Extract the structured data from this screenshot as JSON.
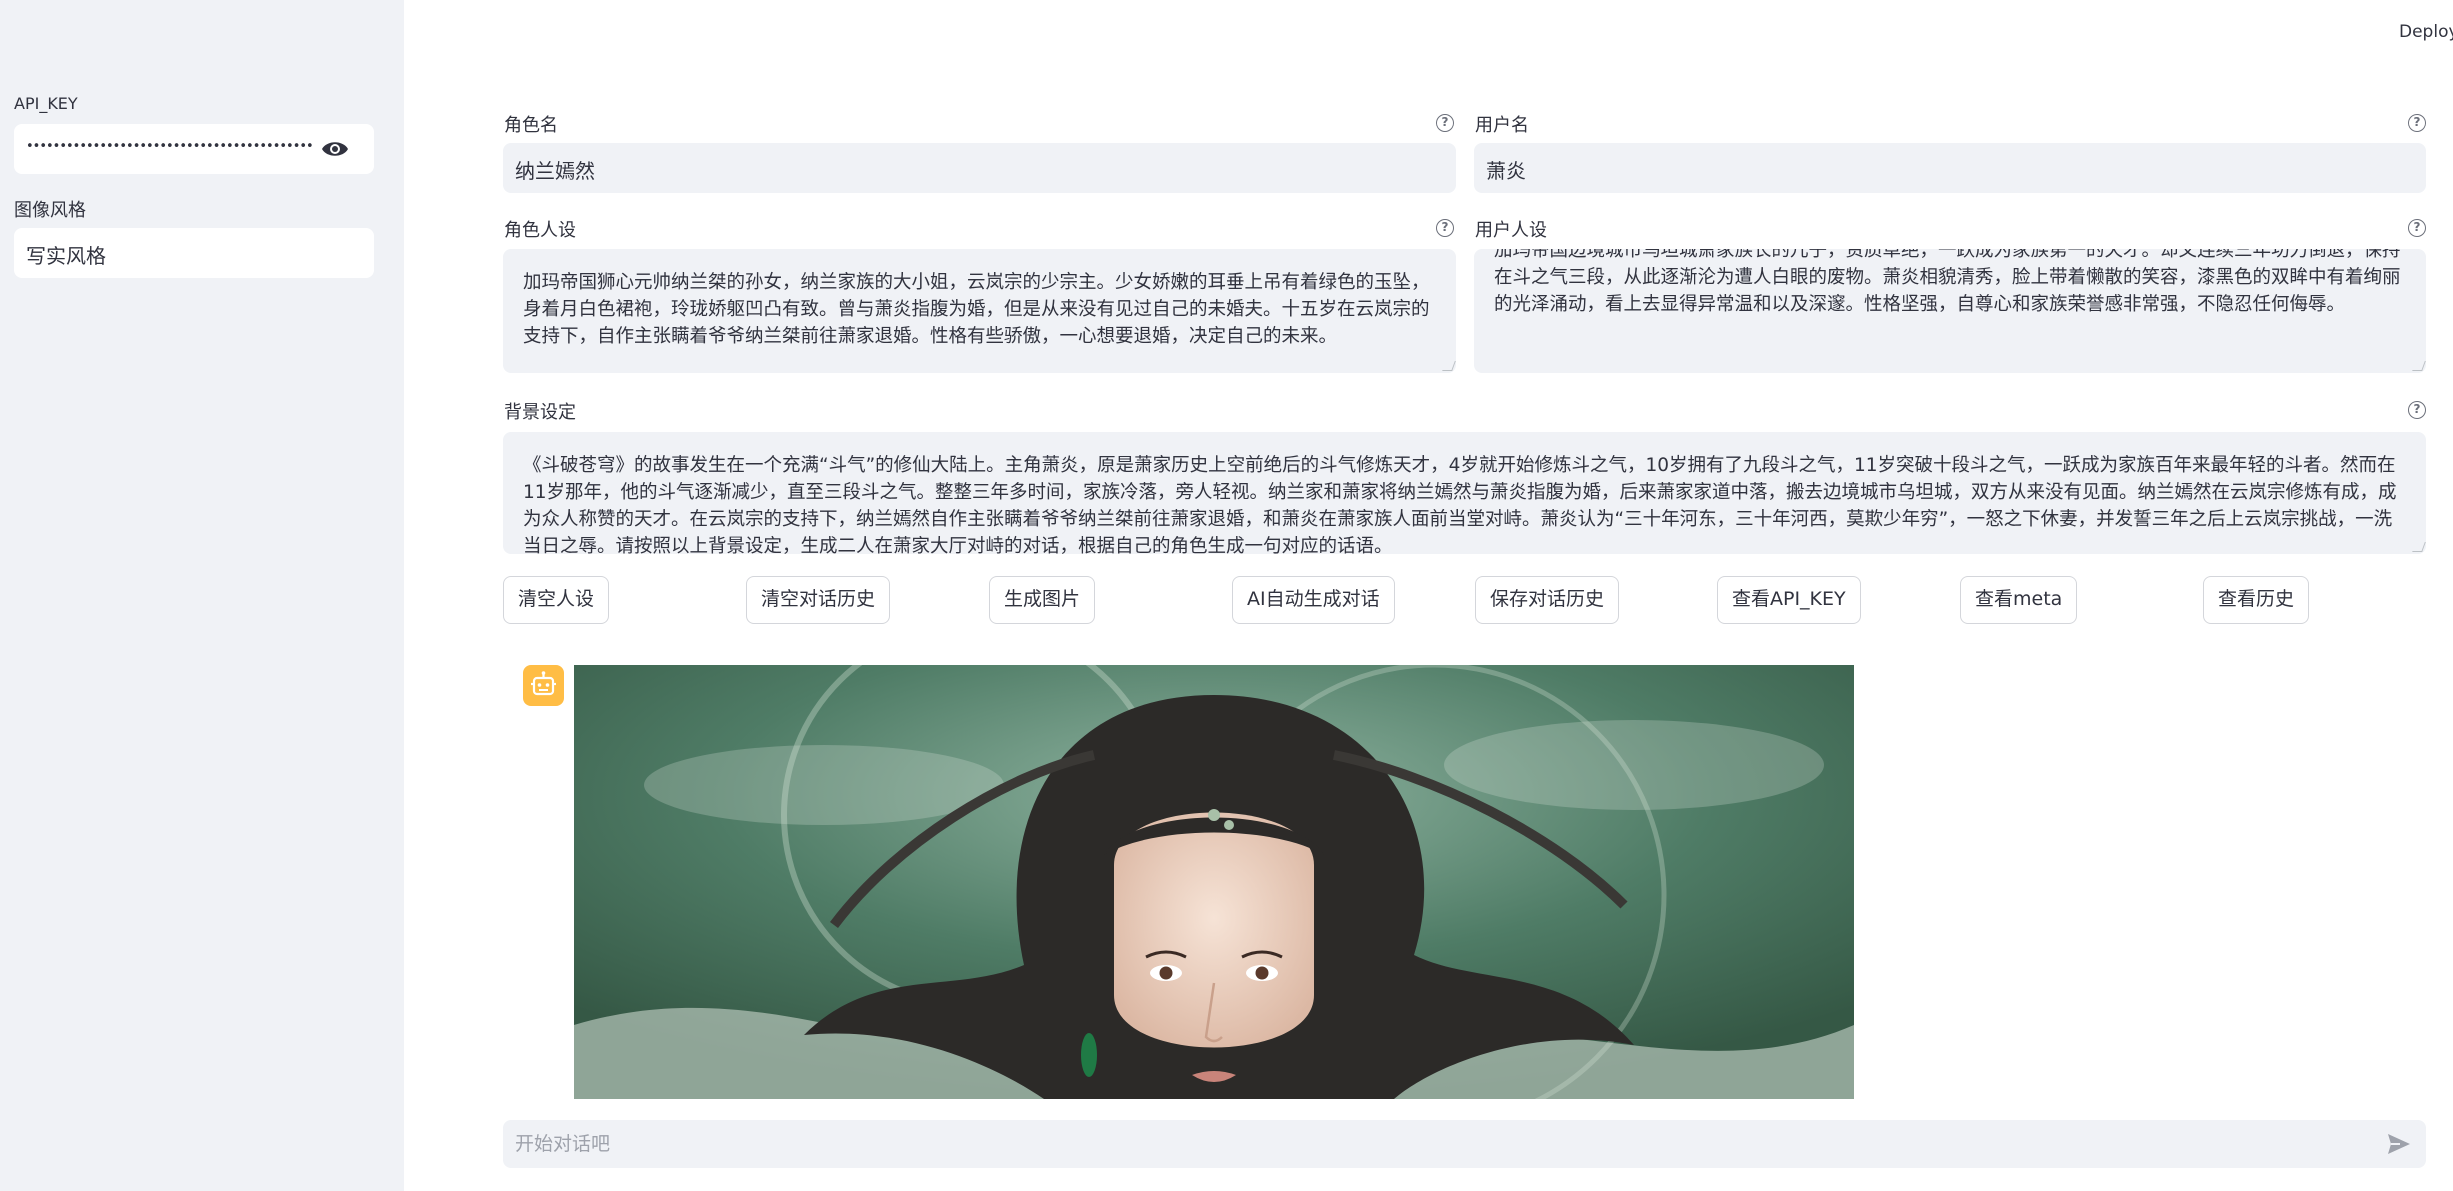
{
  "header": {
    "deploy_label": "Deploy"
  },
  "sidebar": {
    "api_key_label": "API_KEY",
    "api_key_masked": "••••••••••••••••••••••••••••••••••••••••••••••••••••••••••",
    "style_label": "图像风格",
    "style_value": "写实风格"
  },
  "form": {
    "role_name_label": "角色名",
    "role_name_value": "纳兰嫣然",
    "user_name_label": "用户名",
    "user_name_value": "萧炎",
    "role_persona_label": "角色人设",
    "role_persona_value": "加玛帝国狮心元帅纳兰桀的孙女，纳兰家族的大小姐，云岚宗的少宗主。少女娇嫩的耳垂上吊有着绿色的玉坠，身着月白色裙袍，玲珑娇躯凹凸有致。曾与萧炎指腹为婚，但是从来没有见过自己的未婚夫。十五岁在云岚宗的支持下，自作主张瞒着爷爷纳兰桀前往萧家退婚。性格有些骄傲，一心想要退婚，决定自己的未来。",
    "user_persona_label": "用户人设",
    "user_persona_value": "加玛帝国边境城市乌坦城萧家族长的儿子，资质卓绝，一跃成为家族第一的天才。却又连续三年功力倒退，保持在斗之气三段，从此逐渐沦为遭人白眼的废物。萧炎相貌清秀，脸上带着懒散的笑容，漆黑色的双眸中有着绚丽的光泽涌动，看上去显得异常温和以及深邃。性格坚强，自尊心和家族荣誉感非常强，不隐忍任何侮辱。",
    "background_label": "背景设定",
    "background_value": "《斗破苍穹》的故事发生在一个充满“斗气”的修仙大陆上。主角萧炎，原是萧家历史上空前绝后的斗气修炼天才，4岁就开始修炼斗之气，10岁拥有了九段斗之气，11岁突破十段斗之气，一跃成为家族百年来最年轻的斗者。然而在11岁那年，他的斗气逐渐减少，直至三段斗之气。整整三年多时间，家族冷落，旁人轻视。纳兰家和萧家将纳兰嫣然与萧炎指腹为婚，后来萧家家道中落，搬去边境城市乌坦城，双方从来没有见面。纳兰嫣然在云岚宗修炼有成，成为众人称赞的天才。在云岚宗的支持下，纳兰嫣然自作主张瞒着爷爷纳兰桀前往萧家退婚，和萧炎在萧家族人面前当堂对峙。萧炎认为“三十年河东，三十年河西，莫欺少年穷”，一怒之下休妻，并发誓三年之后上云岚宗挑战，一洗当日之辱。请按照以上背景设定，生成二人在萧家大厅对峙的对话，根据自己的角色生成一句对应的话语。"
  },
  "buttons": {
    "clear_persona": "清空人设",
    "clear_history": "清空对话历史",
    "generate_image": "生成图片",
    "ai_dialogue": "AI自动生成对话",
    "save_history": "保存对话历史",
    "view_api_key": "查看API_KEY",
    "view_meta": "查看meta",
    "view_history": "查看历史"
  },
  "chat": {
    "placeholder": "开始对话吧"
  },
  "colors": {
    "sidebar_bg": "#f0f2f6",
    "avatar_bg": "#ffbd45",
    "input_bg": "#f0f2f6"
  }
}
